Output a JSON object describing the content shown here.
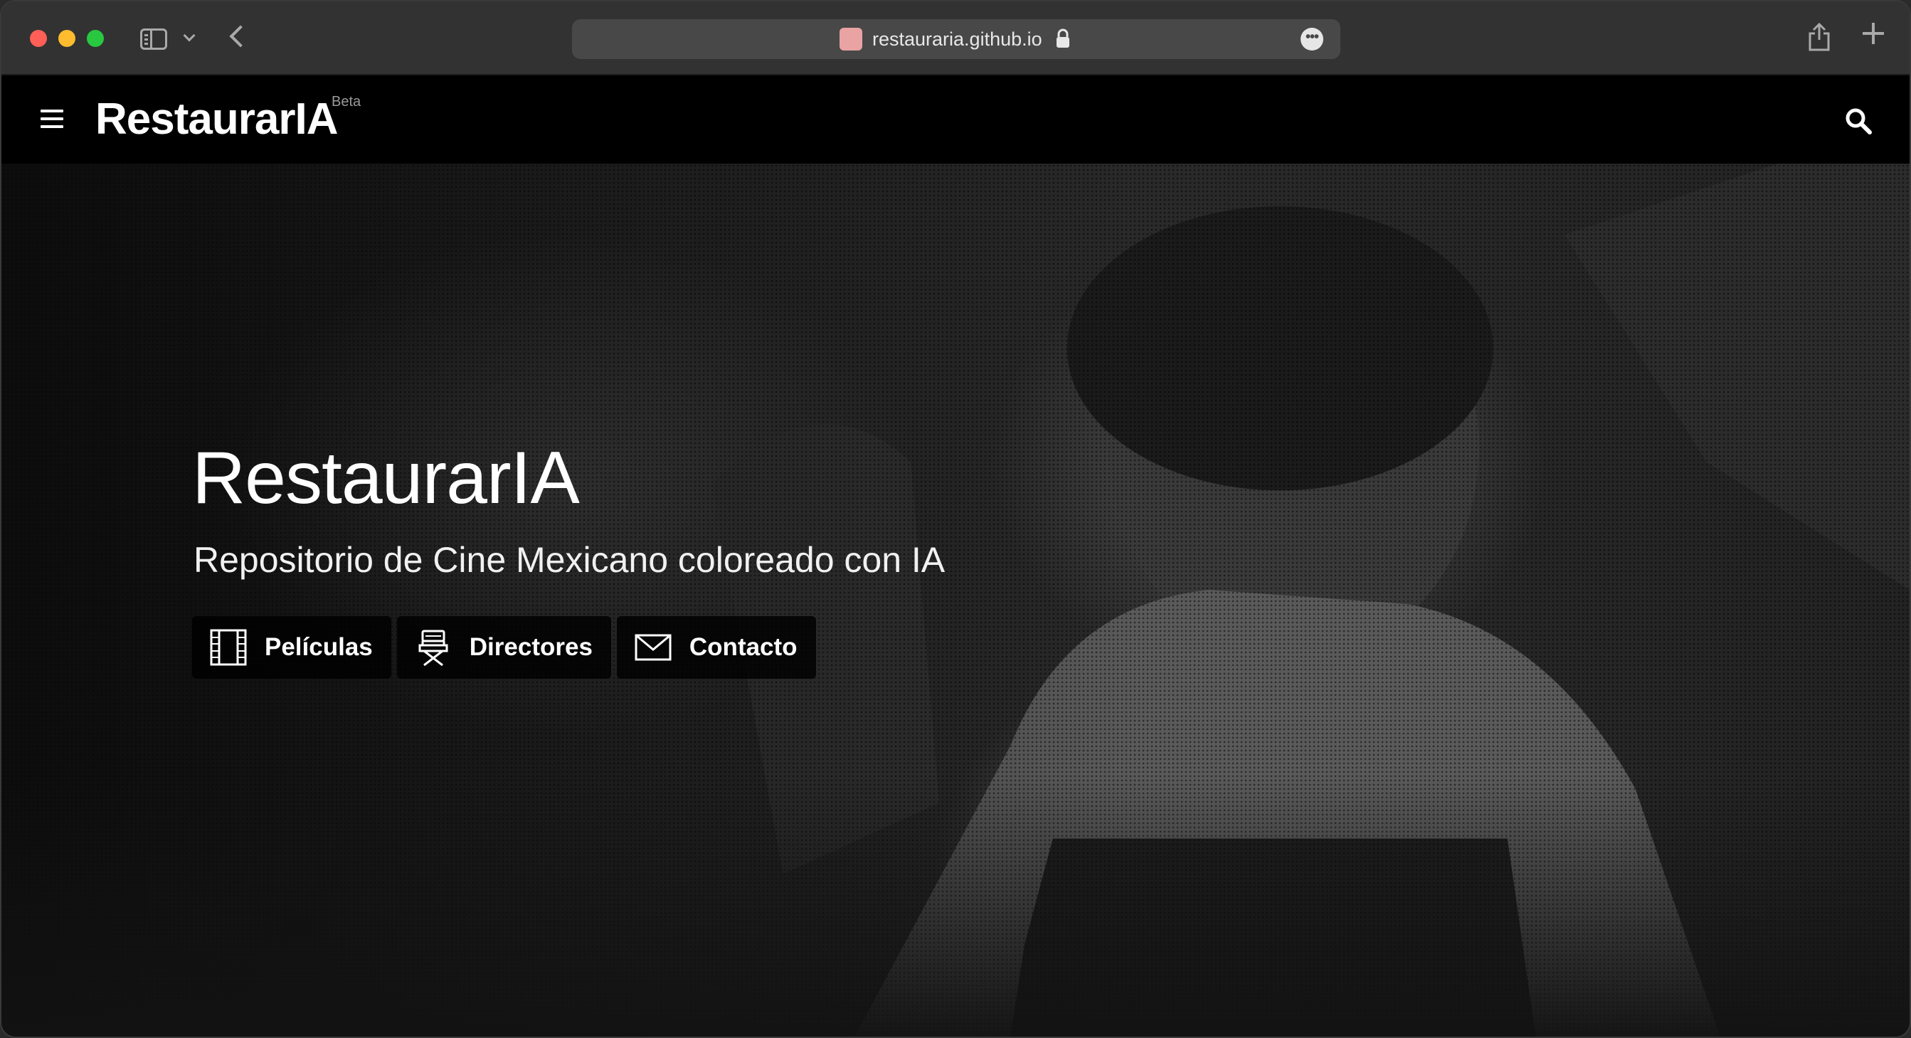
{
  "browser": {
    "url": "restauraria.github.io",
    "more_glyph": "•••"
  },
  "navbar": {
    "brand": "RestaurarIA",
    "badge": "Beta"
  },
  "hero": {
    "title": "RestaurarIA",
    "subtitle": "Repositorio de Cine Mexicano coloreado con IA",
    "buttons": [
      {
        "label": "Películas",
        "icon": "film-strip-icon"
      },
      {
        "label": "Directores",
        "icon": "director-chair-icon"
      },
      {
        "label": "Contacto",
        "icon": "envelope-icon"
      }
    ]
  },
  "colors": {
    "navbar_bg": "#000000",
    "hero_text": "#ffffff",
    "button_bg": "#0a0a0a",
    "chrome_bg": "#323232"
  }
}
